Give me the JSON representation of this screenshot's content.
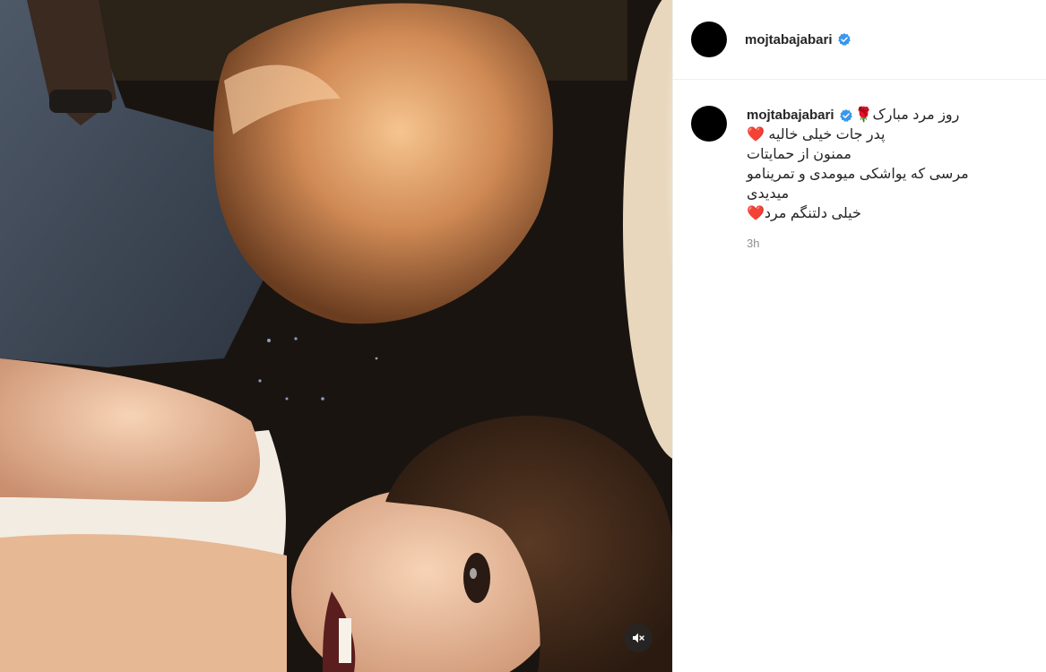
{
  "post": {
    "username": "mojtabajabari",
    "verified": true
  },
  "caption": {
    "username": "mojtabajabari",
    "first_line": "روز مرد مبارک🌹",
    "lines": [
      "پدر جات خیلی خالیه ❤️",
      "ممنون از حمایتات",
      "مرسی که یواشکی میومدی و تمرینامو",
      "میدیدی",
      "خیلی دلتنگم مرد❤️"
    ],
    "time": "3h"
  },
  "media": {
    "type": "video",
    "muted": true,
    "mute_icon": "speaker-muted-icon"
  },
  "colors": {
    "verified": "#3897f0",
    "text": "#262626",
    "muted_text": "#8e8e8e",
    "divider": "#efefef"
  }
}
